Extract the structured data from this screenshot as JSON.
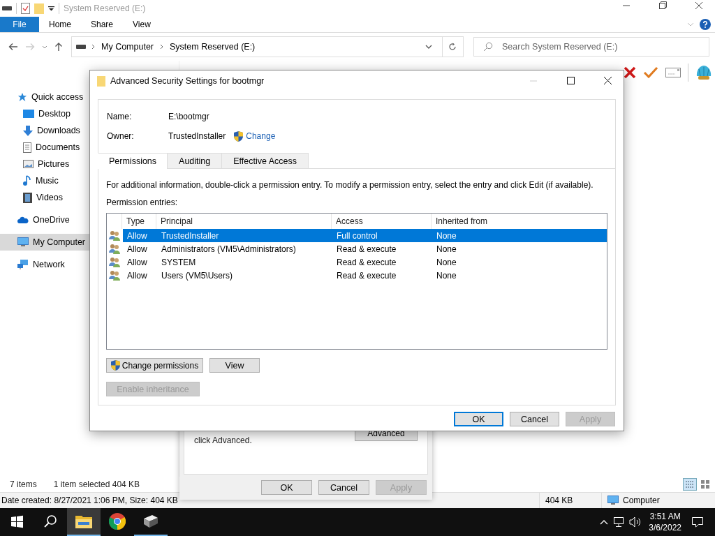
{
  "explorer": {
    "title": "System Reserved (E:)",
    "file_tab": "File",
    "ribbon_tabs": [
      "Home",
      "Share",
      "View"
    ],
    "breadcrumb": [
      "My Computer",
      "System Reserved (E:)"
    ],
    "search": {
      "placeholder": "Search System Reserved (E:)"
    },
    "nav": [
      {
        "label": "Quick access",
        "kind": "star",
        "selected": false,
        "children": [
          {
            "label": "Desktop",
            "kind": "desktop",
            "selected": false
          },
          {
            "label": "Downloads",
            "kind": "download",
            "selected": false
          },
          {
            "label": "Documents",
            "kind": "document",
            "selected": false
          },
          {
            "label": "Pictures",
            "kind": "picture",
            "selected": false
          },
          {
            "label": "Music",
            "kind": "music",
            "selected": false
          },
          {
            "label": "Videos",
            "kind": "video",
            "selected": false
          }
        ]
      },
      {
        "label": "OneDrive",
        "kind": "cloud",
        "selected": false
      },
      {
        "label": "My Computer",
        "kind": "computer",
        "selected": true
      },
      {
        "label": "Network",
        "kind": "network",
        "selected": false
      }
    ],
    "status": {
      "count": "7 items",
      "selection": "1 item selected  404 KB"
    },
    "details_bar": {
      "info": "Date created: 8/27/2021 1:06 PM, Size: 404 KB",
      "size": "404 KB",
      "zone": "Computer"
    }
  },
  "advanced_dialog": {
    "title": "Advanced Security Settings for bootmgr",
    "name_label": "Name:",
    "name": "E:\\bootmgr",
    "owner_label": "Owner:",
    "owner": "TrustedInstaller",
    "change_link": "Change",
    "tabs": [
      {
        "label": "Permissions",
        "selected": true
      },
      {
        "label": "Auditing",
        "selected": false
      },
      {
        "label": "Effective Access",
        "selected": false
      }
    ],
    "info": "For additional information, double-click a permission entry. To modify a permission entry, select the entry and click Edit (if available).",
    "entries_label": "Permission entries:",
    "columns": [
      "Type",
      "Principal",
      "Access",
      "Inherited from"
    ],
    "rows": [
      {
        "type": "Allow",
        "principal": "TrustedInstaller",
        "access": "Full control",
        "inherited": "None",
        "selected": true
      },
      {
        "type": "Allow",
        "principal": "Administrators (VM5\\Administrators)",
        "access": "Read & execute",
        "inherited": "None",
        "selected": false
      },
      {
        "type": "Allow",
        "principal": "SYSTEM",
        "access": "Read & execute",
        "inherited": "None",
        "selected": false
      },
      {
        "type": "Allow",
        "principal": "Users (VM5\\Users)",
        "access": "Read & execute",
        "inherited": "None",
        "selected": false
      }
    ],
    "action_buttons": [
      {
        "label": "Change permissions",
        "kind": "shield"
      },
      {
        "label": "View",
        "kind": "plain"
      }
    ],
    "inheritance_button": {
      "label": "Enable inheritance",
      "disabled": true
    },
    "footer_buttons": [
      {
        "label": "OK",
        "default": true,
        "disabled": false
      },
      {
        "label": "Cancel",
        "default": false,
        "disabled": false
      },
      {
        "label": "Apply",
        "default": false,
        "disabled": true
      }
    ]
  },
  "properties_dialog": {
    "text": "click Advanced.",
    "advanced_button": "Advanced",
    "footer_buttons": [
      {
        "label": "OK",
        "disabled": false
      },
      {
        "label": "Cancel",
        "disabled": false
      },
      {
        "label": "Apply",
        "disabled": true
      }
    ]
  },
  "taskbar": {
    "apps": [
      {
        "kind": "folder",
        "selected": true,
        "running": true
      },
      {
        "kind": "chrome",
        "selected": false,
        "running": false
      },
      {
        "kind": "drive",
        "selected": false,
        "running": true
      }
    ],
    "time": "3:51 AM",
    "date": "3/6/2022"
  }
}
